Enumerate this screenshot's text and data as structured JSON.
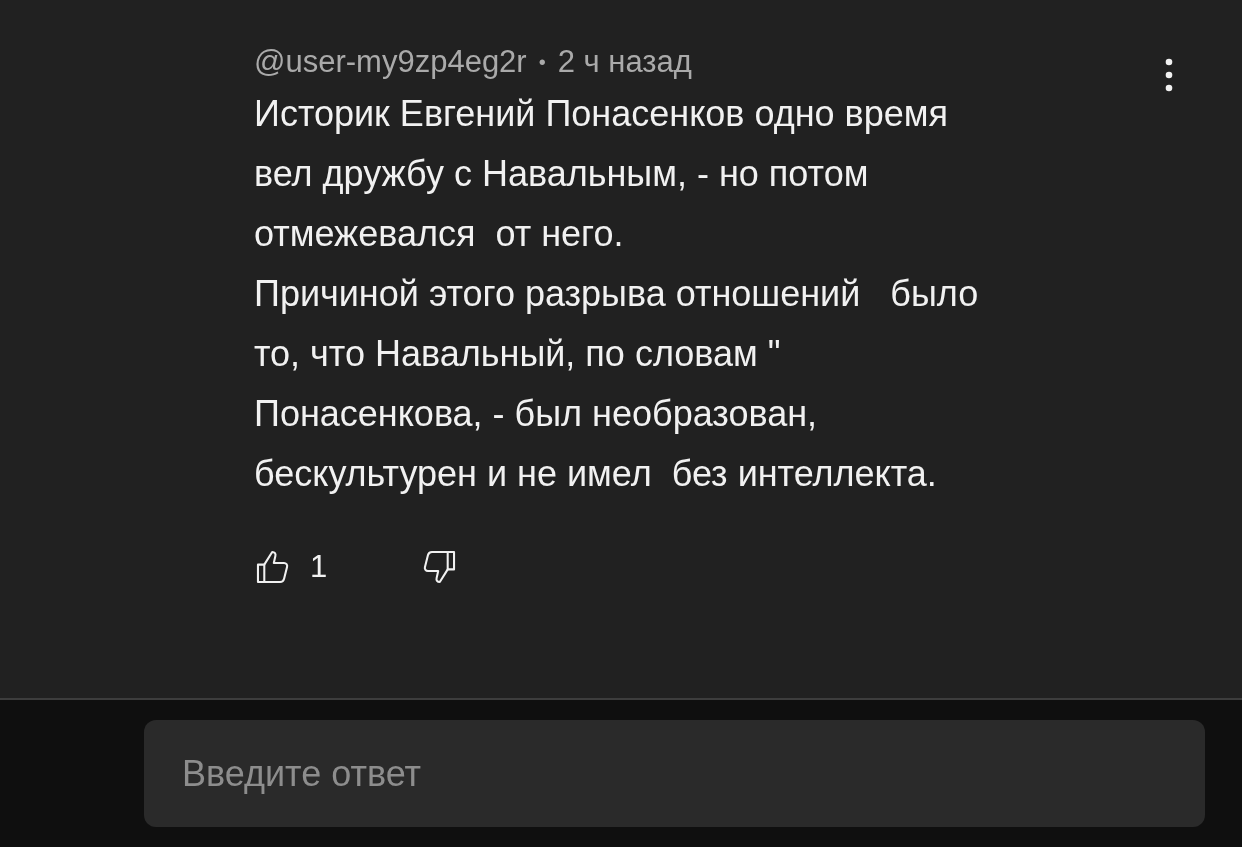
{
  "comment": {
    "author": "@user-my9zp4eg2r",
    "separator": "•",
    "time": "2 ч назад",
    "text": "Историк Евгений Понасенков одно время\nвел дружбу с Навальным, - но потом\nотмежевался  от него.\nПричиной этого разрыва отношений   было\nто, что Навальный, по словам \"\nПонасенкова, - был необразован,\nбескультурен и не имел  без интеллекта.",
    "likes": "1"
  },
  "reply": {
    "placeholder": "Введите ответ"
  }
}
